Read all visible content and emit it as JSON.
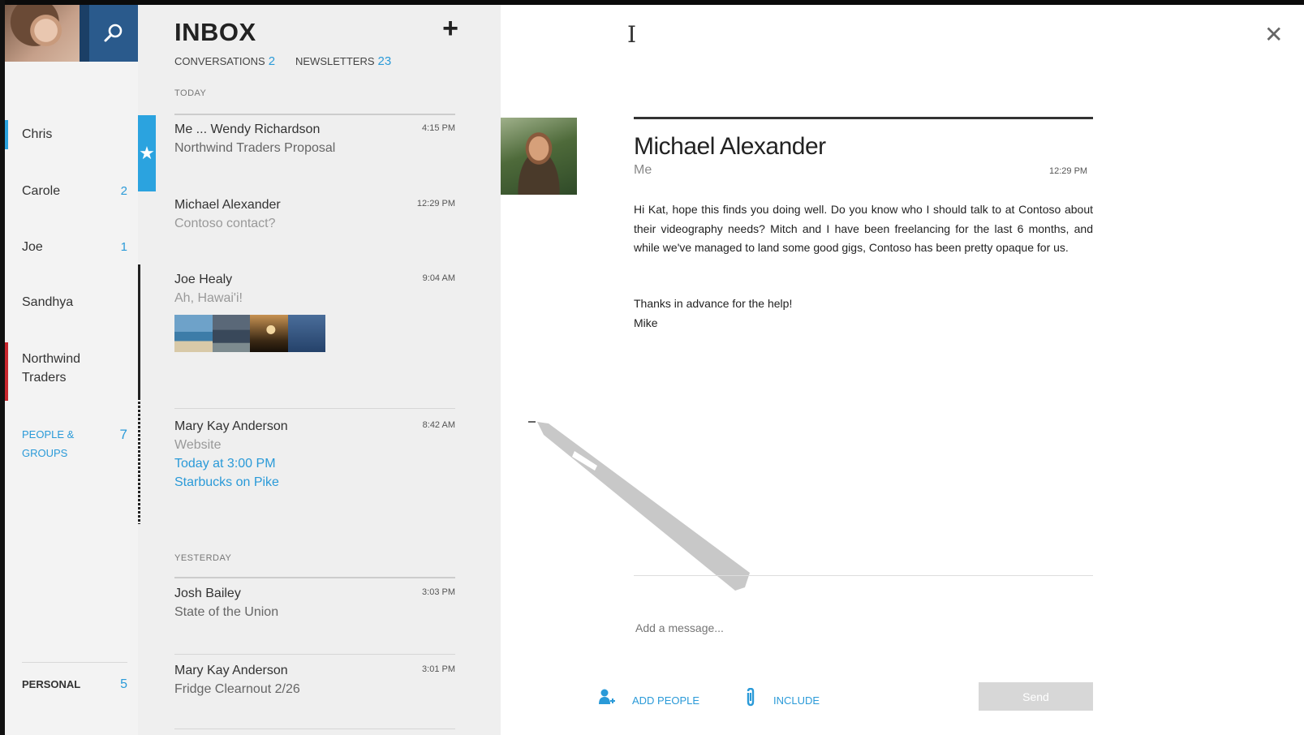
{
  "sidebar": {
    "search_icon": "search-icon",
    "items": [
      {
        "label": "Chris",
        "count": "",
        "accent": "#2ba3df"
      },
      {
        "label": "Carole",
        "count": "2",
        "accent": ""
      },
      {
        "label": "Joe",
        "count": "1",
        "accent": ""
      },
      {
        "label": "Sandhya",
        "count": "",
        "accent": ""
      },
      {
        "label": "Northwind Traders",
        "count": "",
        "accent": "#c8272e"
      }
    ],
    "people_groups": {
      "label": "PEOPLE & GROUPS",
      "count": "7"
    },
    "personal": {
      "label": "PERSONAL",
      "count": "5"
    }
  },
  "inbox": {
    "title": "INBOX",
    "add_label": "+",
    "tabs": [
      {
        "label": "CONVERSATIONS",
        "count": "2"
      },
      {
        "label": "NEWSLETTERS",
        "count": "23"
      }
    ],
    "today_label": "TODAY",
    "yesterday_label": "YESTERDAY",
    "messages_today": [
      {
        "from": "Me ... Wendy Richardson",
        "time": "4:15 PM",
        "subject": "Northwind Traders Proposal",
        "starred": true
      },
      {
        "from": "Michael Alexander",
        "time": "12:29 PM",
        "subject": "Contoso contact?",
        "starred": false
      },
      {
        "from": "Joe Healy",
        "time": "9:04 AM",
        "subject": "Ah, Hawai'i!",
        "starred": false
      },
      {
        "from": "Mary Kay Anderson",
        "time": "8:42 AM",
        "subject": "Website",
        "link1": "Today at 3:00 PM",
        "link2": "Starbucks on Pike",
        "starred": false
      }
    ],
    "messages_yesterday": [
      {
        "from": "Josh Bailey",
        "time": "3:03 PM",
        "subject": "State of the Union"
      },
      {
        "from": "Mary Kay Anderson",
        "time": "3:01 PM",
        "subject": "Fridge Clearnout 2/26"
      }
    ],
    "accent": "#2ba3df"
  },
  "reader": {
    "sender": "Michael Alexander",
    "to": "Me",
    "time": "12:29 PM",
    "paragraphs": [
      "Hi Kat, hope this finds you doing well.  Do you know who I should talk to at Contoso about their videography needs?  Mitch and I have been freelancing for the last 6 months, and while we've managed to land some good gigs, Contoso has been pretty opaque for us."
    ],
    "closing": "Thanks in advance for the help!",
    "signoff": "Mike",
    "compose_placeholder": "Add a message...",
    "add_people_label": "ADD PEOPLE",
    "include_label": "INCLUDE",
    "send_label": "Send",
    "close_icon": "close-icon"
  }
}
